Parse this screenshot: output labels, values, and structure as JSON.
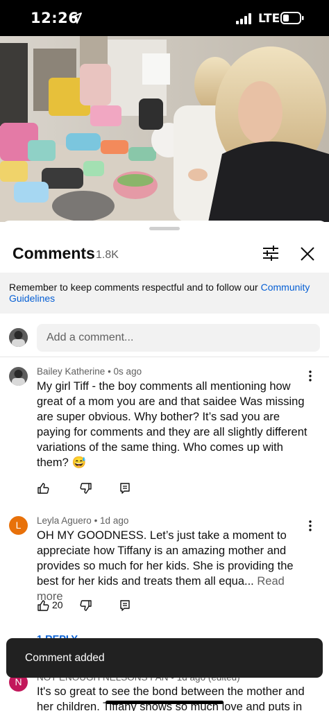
{
  "status_bar": {
    "time": "12:26",
    "network": "LTE"
  },
  "comments_header": {
    "title": "Comments",
    "count": "1.8K"
  },
  "notice": {
    "text": "Remember to keep comments respectful and to follow our ",
    "link": "Community Guidelines"
  },
  "add_comment": {
    "placeholder": "Add a comment..."
  },
  "comments": [
    {
      "author": "Bailey Katherine",
      "time": "0s ago",
      "text": "My girl Tiff - the boy comments all mentioning how great of a mom you are and that saidee Was missing are super obvious. Why bother? It’s sad you are paying for comments and they are all slightly different variations of the same thing. Who comes up with them? 😅"
    },
    {
      "author": "Leyla Aguero",
      "avatar_letter": "L",
      "avatar_color": "#e8710a",
      "time": "1d ago",
      "text": "OH MY GOODNESS. Let’s just take a moment to appreciate how Tiffany is an amazing mother and provides so much for her kids. She is providing the best for her kids and treats them all equa...",
      "read_more": "Read more",
      "likes": "20",
      "replies": "1 REPLY"
    },
    {
      "author": "NOT ENOUGH NELSONS FAN",
      "avatar_letter": "N",
      "avatar_color": "#c2185b",
      "time": "1d ago (edited)",
      "text": "It's so great to see the bond between the mother and her children. Tiffany shows so much love and puts in"
    }
  ],
  "toast": {
    "text": "Comment added"
  }
}
